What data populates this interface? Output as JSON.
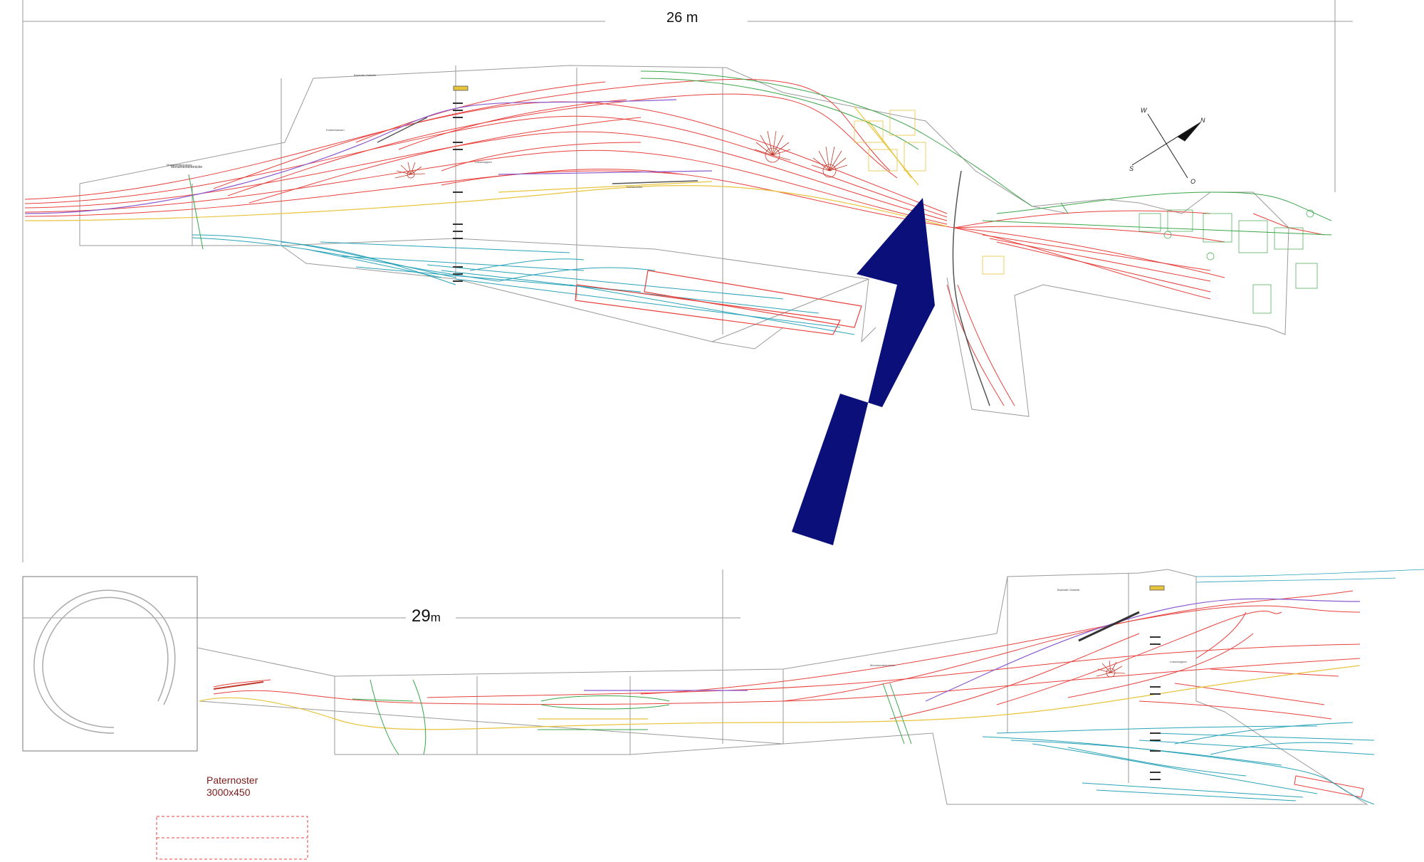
{
  "top_plan": {
    "length_label": "26 m",
    "bridge_label": "Monumentenbrücke",
    "station_labels": [
      "Bauhalle Ostseite",
      "Lokschuppen",
      "Kohlenbansen",
      "Drehscheibe"
    ],
    "compass": {
      "w": "W",
      "n": "N",
      "s": "S",
      "o": "O"
    }
  },
  "bottom_plan": {
    "length_value": "29",
    "length_unit": "m",
    "bridge_label": "Monumentenbrücke",
    "station_labels": [
      "Bauhalle Ostseite",
      "Lokschuppen"
    ]
  },
  "paternoster": {
    "title": "Paternoster",
    "size": "3000x450"
  },
  "colors": {
    "main_track": "#e8403c",
    "secondary_track": "#29a3b8",
    "yard_track": "#e8c43c",
    "green_track": "#3aa64a",
    "purple_track": "#8a5ad0",
    "arrow": "#0a0f7a",
    "outline": "#8a8a8a"
  }
}
